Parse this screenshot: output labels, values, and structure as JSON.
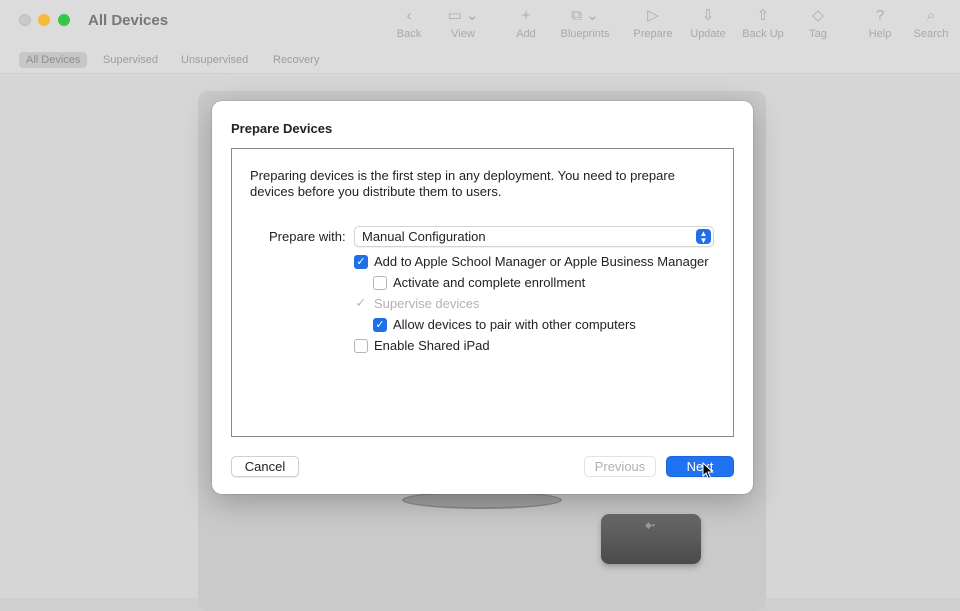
{
  "window": {
    "title": "All Devices",
    "colors": {
      "accent": "#1f72f0",
      "close": "#c9c9c9",
      "minimize": "#f5bc3b",
      "maximize": "#36c748"
    }
  },
  "toolbar": {
    "items": [
      {
        "label": "Back",
        "icon": "chevron-left-icon"
      },
      {
        "label": "View",
        "icon": "view-icon"
      },
      {
        "label": "Add",
        "icon": "plus-icon"
      },
      {
        "label": "Blueprints",
        "icon": "blueprints-icon"
      },
      {
        "label": "Prepare",
        "icon": "prepare-icon"
      },
      {
        "label": "Update",
        "icon": "update-icon"
      },
      {
        "label": "Back Up",
        "icon": "backup-icon"
      },
      {
        "label": "Tag",
        "icon": "tag-icon"
      },
      {
        "label": "Help",
        "icon": "help-icon"
      },
      {
        "label": "Search",
        "icon": "search-icon"
      }
    ]
  },
  "filters": {
    "items": [
      "All Devices",
      "Supervised",
      "Unsupervised",
      "Recovery"
    ],
    "selected": "All Devices"
  },
  "dialog": {
    "title": "Prepare Devices",
    "intro": "Preparing devices is the first step in any deployment. You need to prepare devices before you distribute them to users.",
    "prepare_with_label": "Prepare with:",
    "prepare_with_value": "Manual Configuration",
    "options": [
      {
        "label": "Add to Apple School Manager or Apple Business Manager",
        "checked": true,
        "enabled": true,
        "indent": 0
      },
      {
        "label": "Activate and complete enrollment",
        "checked": false,
        "enabled": true,
        "indent": 1
      },
      {
        "label": "Supervise devices",
        "checked": true,
        "enabled": false,
        "indent": 0
      },
      {
        "label": "Allow devices to pair with other computers",
        "checked": true,
        "enabled": true,
        "indent": 1
      },
      {
        "label": "Enable Shared iPad",
        "checked": false,
        "enabled": true,
        "indent": 0
      }
    ],
    "buttons": {
      "cancel": "Cancel",
      "previous": "Previous",
      "next": "Next"
    }
  }
}
